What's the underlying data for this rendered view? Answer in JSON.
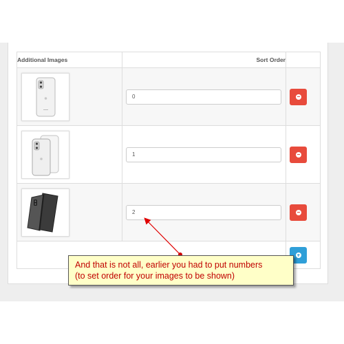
{
  "table": {
    "headers": {
      "images": "Additional Images",
      "sort_order": "Sort Order"
    },
    "rows": [
      {
        "image": "white-phone-back-icon",
        "sort_order": "0"
      },
      {
        "image": "white-phone-front-back-icon",
        "sort_order": "1"
      },
      {
        "image": "black-phone-case-icon",
        "sort_order": "2"
      }
    ]
  },
  "buttons": {
    "remove_icon": "minus-circle-icon",
    "add_icon": "plus-circle-icon",
    "remove_color": "#e84b3c",
    "add_color": "#2f9fd8"
  },
  "callout": {
    "line1": "And that is not all, earlier you had to put numbers",
    "line2": "(to set order for your images to be shown)",
    "background": "#ffffc8",
    "text_color": "#c00000",
    "arrow_color": "#e00000"
  }
}
